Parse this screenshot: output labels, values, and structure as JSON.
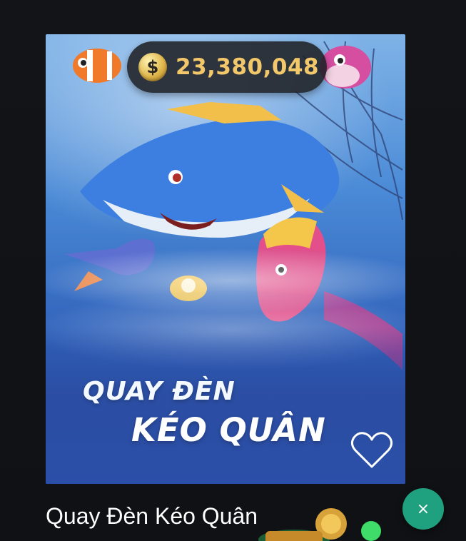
{
  "balance": {
    "currency_icon": "dollar-coin-icon",
    "currency_symbol": "$",
    "amount": "23,380,048"
  },
  "banner": {
    "title_line1": "QUAY ĐÈN",
    "title_line2": "KÉO QUÂN",
    "favorite_icon": "heart-outline-icon"
  },
  "game": {
    "name": "Quay Đèn Kéo Quân"
  },
  "close_button": {
    "label": "×",
    "icon": "close-icon"
  },
  "colors": {
    "background": "#111316",
    "balance_text": "#f2c86b",
    "close_button": "#1fa07e",
    "banner_blue": "#2b4fa8"
  }
}
